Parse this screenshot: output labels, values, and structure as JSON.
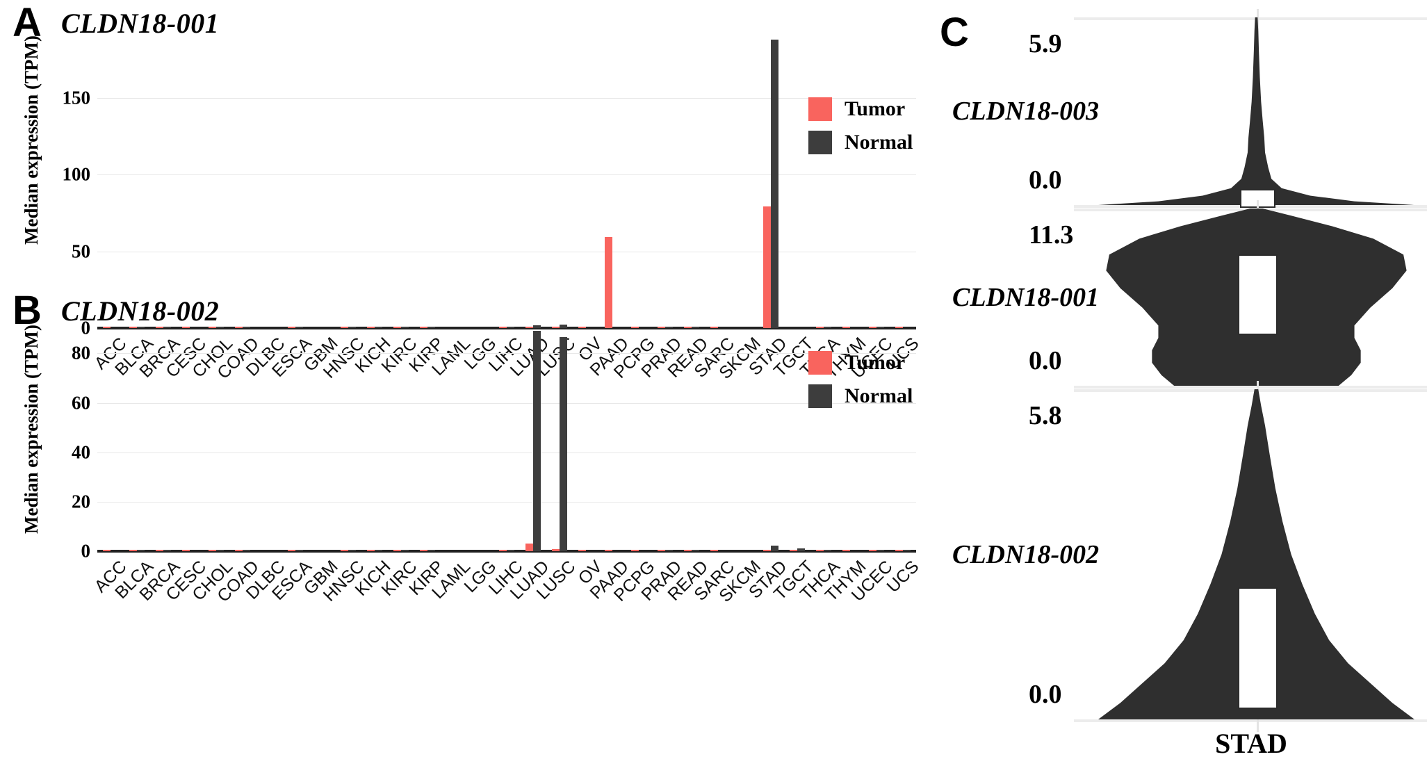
{
  "panels": {
    "a": {
      "letter": "A",
      "title": "CLDN18-001",
      "ylabel": "Median expression (TPM)",
      "legend": {
        "tumor": "Tumor",
        "normal": "Normal"
      }
    },
    "b": {
      "letter": "B",
      "title": "CLDN18-002",
      "ylabel": "Median expression (TPM)",
      "legend": {
        "tumor": "Tumor",
        "normal": "Normal"
      }
    },
    "c": {
      "letter": "C",
      "x_label": "STAD",
      "violins": [
        {
          "gene": "CLDN18-003",
          "max": "5.9",
          "min": "0.0"
        },
        {
          "gene": "CLDN18-001",
          "max": "11.3",
          "min": "0.0"
        },
        {
          "gene": "CLDN18-002",
          "max": "5.8",
          "min": "0.0"
        }
      ]
    }
  },
  "colors": {
    "tumor": "#F9645E",
    "normal": "#3D3D3D",
    "grid": "#E8E8E8",
    "axis": "#222222"
  },
  "chart_data": [
    {
      "type": "bar",
      "panel": "A",
      "title": "CLDN18-001",
      "xlabel": "",
      "ylabel": "Median expression (TPM)",
      "ylim": [
        0,
        200
      ],
      "yticks": [
        0,
        50,
        100,
        150
      ],
      "grid": true,
      "legend_position": "top-right",
      "categories": [
        "ACC",
        "BLCA",
        "BRCA",
        "CESC",
        "CHOL",
        "COAD",
        "DLBC",
        "ESCA",
        "GBM",
        "HNSC",
        "KICH",
        "KIRC",
        "KIRP",
        "LAML",
        "LGG",
        "LIHC",
        "LUAD",
        "LUSC",
        "OV",
        "PAAD",
        "PCPG",
        "PRAD",
        "READ",
        "SARC",
        "SKCM",
        "STAD",
        "TGCT",
        "THCA",
        "THYM",
        "UCEC",
        "UCS"
      ],
      "series": [
        {
          "name": "Tumor",
          "color": "#F9645E",
          "values": [
            0.1,
            0.3,
            0.2,
            0.1,
            0.5,
            0.2,
            0.0,
            0.6,
            0.0,
            0.1,
            0.2,
            0.1,
            0.2,
            0.0,
            0.0,
            0.2,
            0.6,
            0.4,
            0.1,
            59.5,
            0.2,
            0.1,
            0.2,
            0.1,
            0.0,
            79.0,
            0.0,
            0.1,
            0.1,
            0.3,
            0.2
          ]
        },
        {
          "name": "Normal",
          "color": "#3D3D3D",
          "values": [
            0.0,
            0.2,
            0.2,
            0.0,
            0.3,
            0.2,
            0.0,
            0.4,
            0.0,
            0.1,
            0.2,
            0.1,
            0.2,
            0.0,
            0.0,
            0.1,
            2.0,
            2.1,
            0.0,
            0.0,
            0.0,
            0.1,
            0.2,
            0.0,
            0.0,
            188.0,
            0.0,
            0.2,
            0.0,
            0.4,
            0.0
          ]
        }
      ]
    },
    {
      "type": "bar",
      "panel": "B",
      "title": "CLDN18-002",
      "xlabel": "",
      "ylabel": "Median expression (TPM)",
      "ylim": [
        0,
        95
      ],
      "yticks": [
        0,
        20,
        40,
        60,
        80
      ],
      "grid": true,
      "legend_position": "top-right",
      "categories": [
        "ACC",
        "BLCA",
        "BRCA",
        "CESC",
        "CHOL",
        "COAD",
        "DLBC",
        "ESCA",
        "GBM",
        "HNSC",
        "KICH",
        "KIRC",
        "KIRP",
        "LAML",
        "LGG",
        "LIHC",
        "LUAD",
        "LUSC",
        "OV",
        "PAAD",
        "PCPG",
        "PRAD",
        "READ",
        "SARC",
        "SKCM",
        "STAD",
        "TGCT",
        "THCA",
        "THYM",
        "UCEC",
        "UCS"
      ],
      "series": [
        {
          "name": "Tumor",
          "color": "#F9645E",
          "values": [
            0.1,
            0.3,
            0.4,
            0.1,
            0.5,
            0.2,
            0.0,
            0.4,
            0.0,
            0.1,
            0.3,
            0.7,
            0.4,
            0.0,
            0.0,
            0.2,
            3.0,
            0.8,
            0.2,
            0.3,
            0.1,
            0.2,
            0.2,
            0.2,
            0.0,
            0.7,
            0.1,
            0.2,
            0.1,
            0.3,
            0.3
          ]
        },
        {
          "name": "Normal",
          "color": "#3D3D3D",
          "values": [
            0.0,
            0.2,
            0.3,
            0.0,
            0.3,
            0.2,
            0.0,
            0.2,
            0.0,
            0.1,
            0.2,
            0.4,
            0.3,
            0.0,
            0.0,
            0.1,
            89.0,
            86.5,
            0.0,
            0.0,
            0.0,
            0.1,
            0.2,
            0.0,
            0.0,
            2.3,
            1.0,
            0.2,
            0.0,
            0.3,
            0.6
          ]
        }
      ]
    },
    {
      "type": "violin",
      "panel": "C",
      "xlabel": "STAD",
      "ylabel": "",
      "groups": [
        {
          "name": "CLDN18-003",
          "ymin": 0.0,
          "ymax": 5.9,
          "median": 0.15,
          "q1": 0.0,
          "q3": 0.45
        },
        {
          "name": "CLDN18-001",
          "ymin": 0.0,
          "ymax": 11.3,
          "median": 5.2,
          "q1": 3.6,
          "q3": 8.3
        },
        {
          "name": "CLDN18-002",
          "ymin": 0.0,
          "ymax": 5.8,
          "median": 0.9,
          "q1": 0.3,
          "q3": 2.3
        }
      ]
    }
  ]
}
